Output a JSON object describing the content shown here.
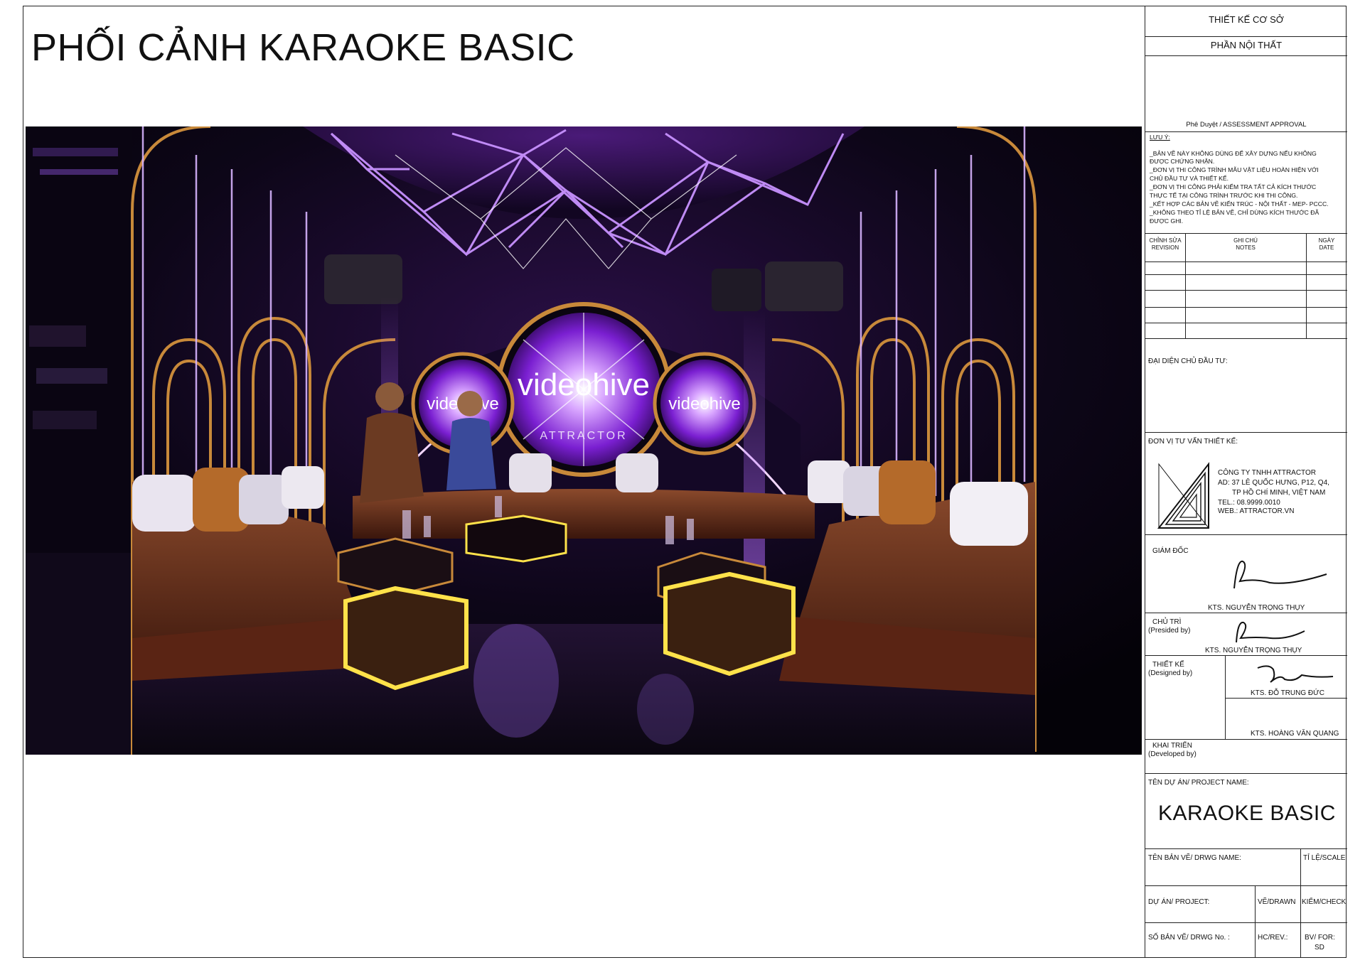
{
  "title": "PHỐI CẢNH KARAOKE BASIC",
  "render": {
    "screen_text_center": "videohive",
    "screen_text_left": "videohive",
    "screen_text_right": "videohive",
    "watermark": "ATTRACTOR"
  },
  "title_block": {
    "design_stage": "THIẾT KẾ CƠ SỞ",
    "section": "PHẦN NỘI THẤT",
    "approval": "Phê Duyệt / ASSESSMENT APPROVAL",
    "notes_heading": "LƯU Ý:",
    "notes": [
      "_BẢN VẼ NÀY KHÔNG DÙNG ĐỂ XÂY DỰNG NẾU KHÔNG",
      "ĐƯỢC CHỨNG NHẬN.",
      "_ĐƠN VỊ THI CÔNG TRÌNH MẪU VẬT LIỆU HOÀN HIỆN VỚI",
      "CHỦ ĐẦU TƯ VÀ THIẾT KẾ.",
      "_ĐƠN VỊ THI CÔNG PHẢI KIỂM TRA TẤT CẢ KÍCH THƯỚC",
      "THỰC TẾ TẠI CÔNG TRÌNH TRƯỚC KHI THI CÔNG.",
      "_KẾT HỢP CÁC BẢN VẼ KIẾN TRÚC - NỘI THẤT - MEP- PCCC.",
      "_KHÔNG THEO TỈ LỆ BẢN VẼ, CHỈ DÙNG KÍCH THƯỚC ĐÃ",
      "ĐƯỢC GHI."
    ],
    "revision_headers": {
      "revision": "CHỈNH SỬA\nREVISION",
      "notes": "GHI CHÚ\nNOTES",
      "date": "NGÀY\nDATE"
    },
    "owner_rep_label": "ĐẠI DIỆN CHỦ ĐẦU TƯ:",
    "consultant_label": "ĐƠN VỊ TƯ VẤN THIẾT KẾ:",
    "company": {
      "name": "CÔNG TY TNHH ATTRACTOR",
      "address1": "AD: 37 LÊ QUỐC HƯNG, P12, Q4,",
      "address2": "TP HỒ CHÍ MINH, VIỆT NAM",
      "tel": "TEL.: 08.9999.0010",
      "web": "WEB.: ATTRACTOR.VN"
    },
    "director_label": "GIÁM ĐỐC",
    "director_name": "KTS. NGUYỄN TRỌNG THỤY",
    "presided_label": "CHỦ TRÌ",
    "presided_label_en": "(Presided by)",
    "presided_name": "KTS. NGUYỄN TRỌNG THỤY",
    "designed_label": "THIẾT KẾ",
    "designed_label_en": "(Designed by)",
    "designed_name_1": "KTS. ĐỖ TRUNG ĐỨC",
    "designed_name_2": "KTS. HOÀNG VĂN QUANG",
    "developed_label": "KHAI TRIỂN",
    "developed_label_en": "(Developed by)",
    "project_name_label": "TÊN DỰ ÁN/ PROJECT NAME:",
    "project_name": "KARAOKE BASIC",
    "drawing_name_label": "TÊN BẢN VẼ/ DRWG NAME:",
    "scale_label": "TỈ LỆ/SCALE",
    "project_label": "DỰ ÁN/ PROJECT:",
    "drawn_label": "VẼ/DRAWN",
    "check_label": "KIỂM/CHECK",
    "drwg_no_label": "SỐ BẢN VẼ/ DRWG No. :",
    "rev_label": "HC/REV.:",
    "for_label": "BV/ FOR:",
    "for_value": "SD"
  },
  "colors": {
    "neon_purple": "#a24bff",
    "gold": "#c8893a",
    "leather": "#6a2e1a",
    "led_yellow": "#ffe24a"
  }
}
